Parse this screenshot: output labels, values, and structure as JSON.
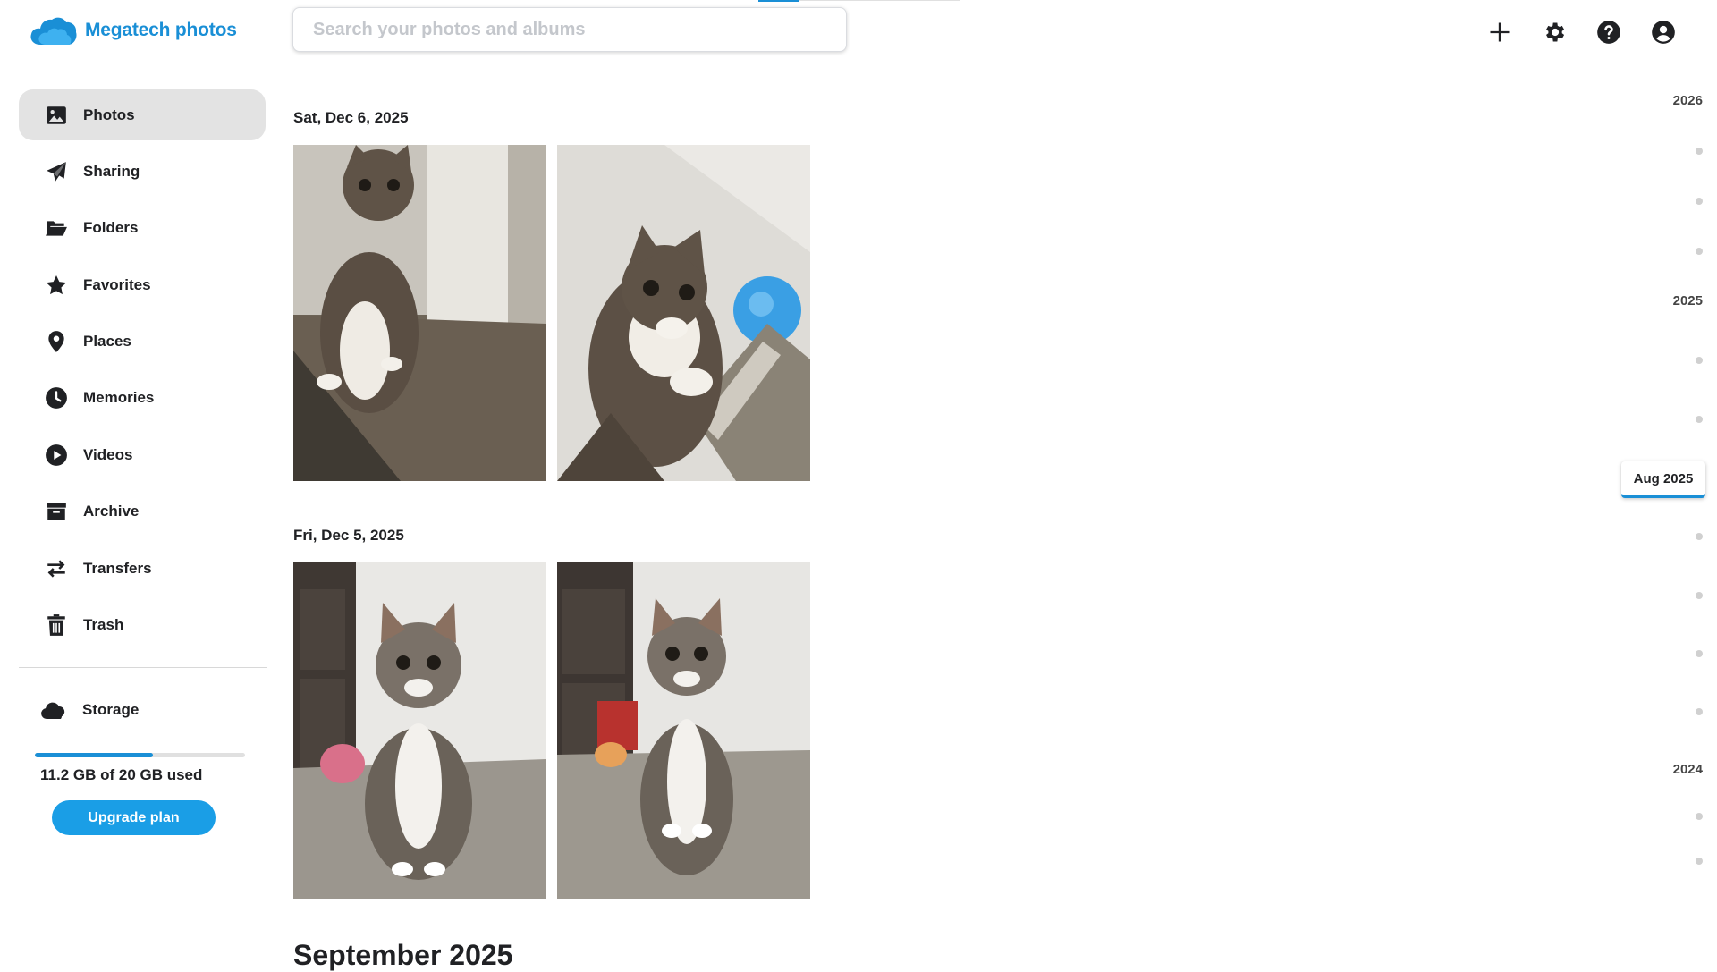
{
  "app": {
    "name": "Megatech photos"
  },
  "search": {
    "placeholder": "Search your photos and albums",
    "value": ""
  },
  "header_actions": [
    {
      "name": "add-icon",
      "tooltip": "Add"
    },
    {
      "name": "gear-icon",
      "tooltip": "Settings"
    },
    {
      "name": "help-icon",
      "tooltip": "Help"
    },
    {
      "name": "account-icon",
      "tooltip": "Account"
    }
  ],
  "sidebar": {
    "items": [
      {
        "label": "Photos",
        "icon": "photo-icon",
        "active": true
      },
      {
        "label": "Sharing",
        "icon": "send-icon",
        "active": false
      },
      {
        "label": "Folders",
        "icon": "folder-open-icon",
        "active": false
      },
      {
        "label": "Favorites",
        "icon": "star-icon",
        "active": false
      },
      {
        "label": "Places",
        "icon": "map-pin-icon",
        "active": false
      },
      {
        "label": "Memories",
        "icon": "clock-icon",
        "active": false
      },
      {
        "label": "Videos",
        "icon": "play-circle-icon",
        "active": false
      },
      {
        "label": "Archive",
        "icon": "archive-box-icon",
        "active": false
      },
      {
        "label": "Transfers",
        "icon": "swap-arrows-icon",
        "active": false
      },
      {
        "label": "Trash",
        "icon": "trash-icon",
        "active": false
      }
    ],
    "storage": {
      "label": "Storage",
      "icon": "cloud-icon",
      "usage_text": "11.2 GB of 20 GB used",
      "used_fraction": 0.56,
      "upgrade_label": "Upgrade plan"
    }
  },
  "groups": [
    {
      "date": "Sat, Dec 6, 2025",
      "photos": [
        {
          "subject": "tabby-white cat sitting on wood floor"
        },
        {
          "subject": "tabby-white cat looking up beside chair"
        }
      ]
    },
    {
      "date": "Fri, Dec 5, 2025",
      "photos": [
        {
          "subject": "tabby-white cat sitting facing camera"
        },
        {
          "subject": "tabby-white cat sitting in kitchen"
        }
      ]
    }
  ],
  "next_month_heading": "September 2025",
  "timeline": {
    "years": [
      "2026",
      "2025",
      "2024"
    ],
    "current": "Aug 2025"
  },
  "colors": {
    "accent": "#1a8fd6",
    "upgrade_button": "#1a9ee6",
    "active_nav_bg": "#e3e3e3"
  }
}
